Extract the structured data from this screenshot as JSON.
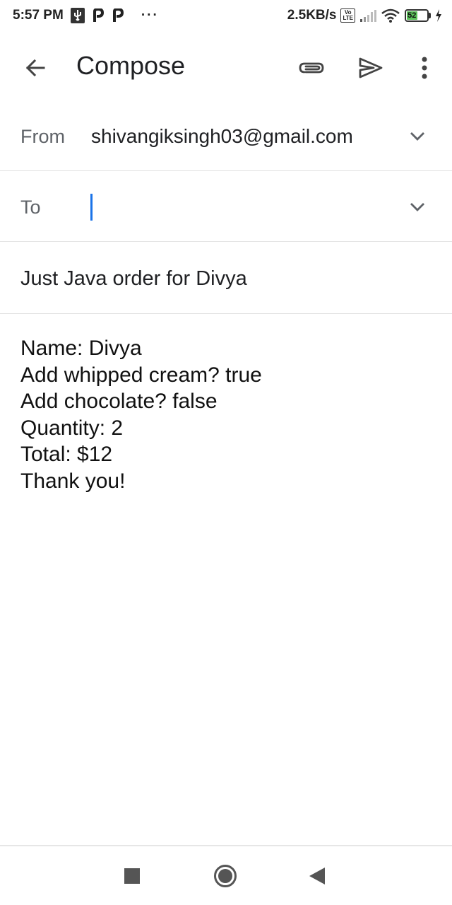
{
  "status_bar": {
    "time": "5:57 PM",
    "left_icons": [
      "usb-icon",
      "p-app-icon",
      "p-app-icon"
    ],
    "overflow": "···",
    "net_speed": "2.5KB/s",
    "volte": "Vo\nLTE",
    "battery_level": "52",
    "battery_fraction": 0.52,
    "battery_color": "#5cc15a",
    "charging": true
  },
  "app_bar": {
    "title": "Compose",
    "icons": [
      "back-arrow-icon",
      "attachment-icon",
      "send-icon",
      "more-vert-icon"
    ]
  },
  "compose": {
    "from_label": "From",
    "from_value": "shivangiksingh03@gmail.com",
    "to_label": "To",
    "to_value": "",
    "subject": "Just Java order for Divya",
    "body_lines": [
      "Name: Divya",
      "Add whipped cream? true",
      "Add chocolate? false",
      "Quantity: 2",
      "Total: $12",
      "Thank you!"
    ]
  },
  "colors": {
    "caret": "#1a73e8",
    "icon": "#5f6368",
    "divider": "#e3e3e3"
  },
  "nav_bar": {
    "buttons": [
      "recents-icon",
      "home-icon",
      "back-icon"
    ]
  }
}
